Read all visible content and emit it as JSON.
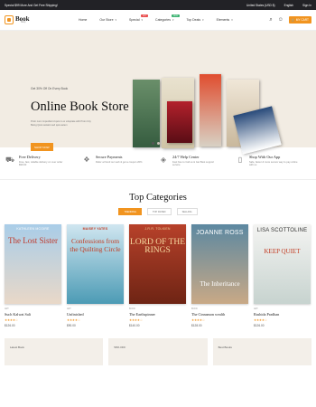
{
  "topbar": {
    "promo": "Special $99 More And Get Free Shipping!",
    "region": "United States (USD $)",
    "language": "English",
    "account": "Sign In"
  },
  "header": {
    "logo_name": "Book",
    "logo_sub": "Shop",
    "nav": [
      {
        "label": "Home",
        "badge": ""
      },
      {
        "label": "Our Store",
        "badge": ""
      },
      {
        "label": "Special",
        "badge": "HOT"
      },
      {
        "label": "Categories",
        "badge": "NEW"
      },
      {
        "label": "Top Deals",
        "badge": ""
      },
      {
        "label": "Elements",
        "badge": ""
      }
    ],
    "cart_label": "MY CART"
  },
  "hero": {
    "small": "Get 30% Off On Every Book",
    "title": "Online Book Store",
    "desc": "Proin nunc imperdiet id quis in ex voluptate with Proin City Being Quis sustaini sed quis autem",
    "button": "SHOP NOW"
  },
  "features": [
    {
      "title": "Free Delivery",
      "desc": "Free, fast, reliable delivery on over order $99.00"
    },
    {
      "title": "Secure Payments",
      "desc": "Refer a friend our web & get a coupon 20%"
    },
    {
      "title": "24/7 Help Center",
      "desc": "Feel free to Call us & Get Best support service"
    },
    {
      "title": "Shop With Our App",
      "desc": "Safe, faster & more secure way to pay online with us"
    }
  ],
  "categories": {
    "title": "Top Categories",
    "tabs": [
      "TRENDING",
      "TOP RATED",
      "SELLING"
    ]
  },
  "products": [
    {
      "author": "KATHLEEN MCGIRE",
      "cover_title": "The Lost Sister",
      "cat": "ART",
      "name": "Such Kalwat Sali",
      "price": "$126.00",
      "bg": "#9bc3e2"
    },
    {
      "author": "MAISEY YATES",
      "cover_title": "Confessions from the Quilting Circle",
      "cat": "ART",
      "name": "Unfinished",
      "price": "$90.00",
      "bg": "#4c9bb5"
    },
    {
      "author": "J.R.R. TOLKIEN",
      "cover_title": "LORD OF THE RINGS",
      "cat": "BOOK",
      "name": "The Earthspinner",
      "price": "$140.00",
      "bg": "#b7412a"
    },
    {
      "author": "JOANNE ROSS",
      "cover_title": "The Inheritance",
      "cat": "BOOK",
      "name": "The Cinnamon wealth",
      "price": "$128.00",
      "bg": "#5c88a1"
    },
    {
      "author": "LISA SCOTTOLINE",
      "cover_title": "KEEP QUIET",
      "cat": "ART",
      "name": "Rashida Pradhan",
      "price": "$126.00",
      "bg": "#eef0ee"
    }
  ],
  "bottom_cards": [
    "Latest Book",
    "50% OFF",
    "Best Books"
  ],
  "colors": {
    "accent": "#f1941f",
    "hero_bg": "#f2ece3",
    "topbar": "#222226"
  }
}
